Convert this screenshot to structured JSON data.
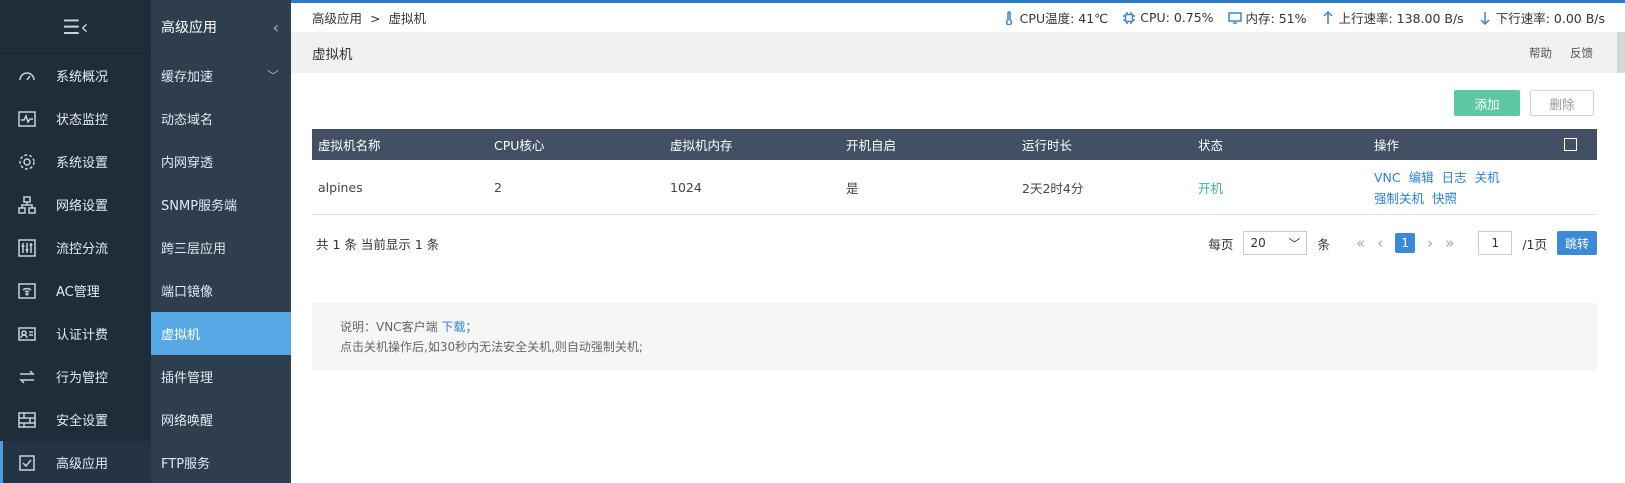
{
  "primary_nav": {
    "collapse_icon": "menu-collapse-icon",
    "items": [
      {
        "label": "系统概况",
        "icon": "dashboard-icon"
      },
      {
        "label": "状态监控",
        "icon": "monitor-icon"
      },
      {
        "label": "系统设置",
        "icon": "gear-icon"
      },
      {
        "label": "网络设置",
        "icon": "network-icon"
      },
      {
        "label": "流控分流",
        "icon": "sliders-icon"
      },
      {
        "label": "AC管理",
        "icon": "wifi-icon"
      },
      {
        "label": "认证计费",
        "icon": "id-card-icon"
      },
      {
        "label": "行为管控",
        "icon": "swap-icon"
      },
      {
        "label": "安全设置",
        "icon": "firewall-icon"
      },
      {
        "label": "高级应用",
        "icon": "checklist-icon"
      }
    ]
  },
  "secondary_nav": {
    "title": "高级应用",
    "items": [
      {
        "label": "缓存加速"
      },
      {
        "label": "动态域名"
      },
      {
        "label": "内网穿透"
      },
      {
        "label": "SNMP服务端"
      },
      {
        "label": "跨三层应用"
      },
      {
        "label": "端口镜像"
      },
      {
        "label": "虚拟机"
      },
      {
        "label": "插件管理"
      },
      {
        "label": "网络唤醒"
      },
      {
        "label": "FTP服务"
      }
    ]
  },
  "breadcrumb": {
    "parent": "高级应用",
    "sep": ">",
    "current": "虚拟机"
  },
  "stats": {
    "cpu_temp": "CPU温度: 41℃",
    "cpu": "CPU: 0.75%",
    "mem": "内存: 51%",
    "up": "上行速率: 138.00 B/s",
    "down": "下行速率: 0.00 B/s"
  },
  "page": {
    "title": "虚拟机",
    "help": "帮助",
    "feedback": "反馈"
  },
  "toolbar": {
    "add": "添加",
    "delete": "删除"
  },
  "table": {
    "headers": [
      "虚拟机名称",
      "CPU核心",
      "虚拟机内存",
      "开机自启",
      "运行时长",
      "状态",
      "操作"
    ],
    "rows": [
      {
        "name": "alpines",
        "cpu": "2",
        "memory": "1024",
        "autostart": "是",
        "uptime": "2天2时4分",
        "status": "开机",
        "ops": [
          "VNC",
          "编辑",
          "日志",
          "关机"
        ],
        "ops2": [
          "强制关机",
          "快照"
        ]
      }
    ]
  },
  "pager": {
    "summary": "共 1 条 当前显示 1 条",
    "per_page_label": "每页",
    "per_page": "20",
    "unit": "条",
    "current": "1",
    "page_input": "1",
    "total": "/1页",
    "jump": "跳转"
  },
  "notice": {
    "prefix": "说明：VNC客户端 ",
    "link": "下载",
    "suffix": "；",
    "line2": "点击关机操作后,如30秒内无法安全关机,则自动强制关机;"
  },
  "colors": {
    "accent": "#3b8ad9",
    "add_button": "#5ec8a3",
    "sidebar": "#1f2c3a",
    "subsidebar": "#2f3e4e",
    "active_sub": "#58a8e6"
  }
}
